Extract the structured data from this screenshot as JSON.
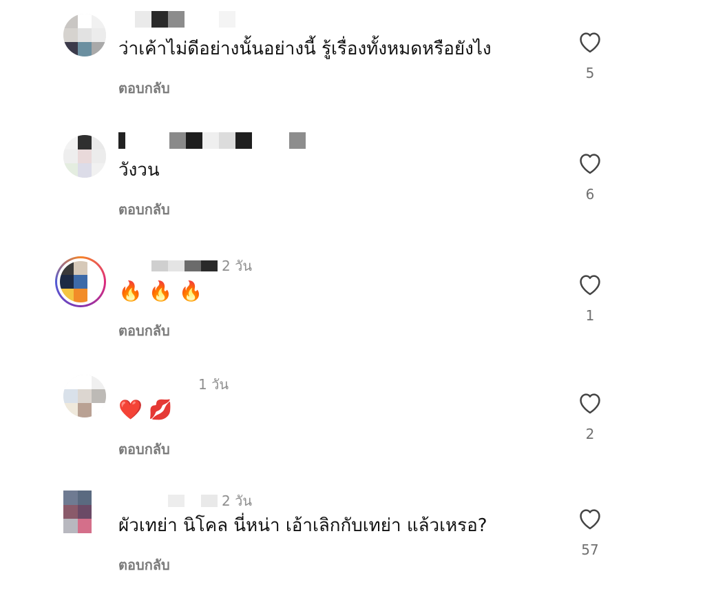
{
  "comments": [
    {
      "text": "ว่าเค้าไม่ดีอย่างนั้นอย่างนี้ รู้เรื่องทั้งหมดหรือยังไง",
      "time": "",
      "reply_label": "ตอบกลับ",
      "likes": "5"
    },
    {
      "text": "วังวน",
      "time": "",
      "reply_label": "ตอบกลับ",
      "likes": "6"
    },
    {
      "text": "🔥 🔥 🔥",
      "time": "2 วัน",
      "reply_label": "ตอบกลับ",
      "likes": "1"
    },
    {
      "text": "❤️ 💋",
      "time": "1 วัน",
      "reply_label": "ตอบกลับ",
      "likes": "2"
    },
    {
      "text": "ผัวเทย่า นิโคล นี่หน่า เอ้าเลิกกับเทย่า แล้วเหรอ?",
      "time": "2 วัน",
      "reply_label": "ตอบกลับ",
      "likes": "57"
    }
  ],
  "icons": {
    "like": "heart-outline-icon"
  },
  "colors": {
    "reply": "#7a7a7a",
    "count": "#6f6f6f",
    "icon": "#444444"
  }
}
